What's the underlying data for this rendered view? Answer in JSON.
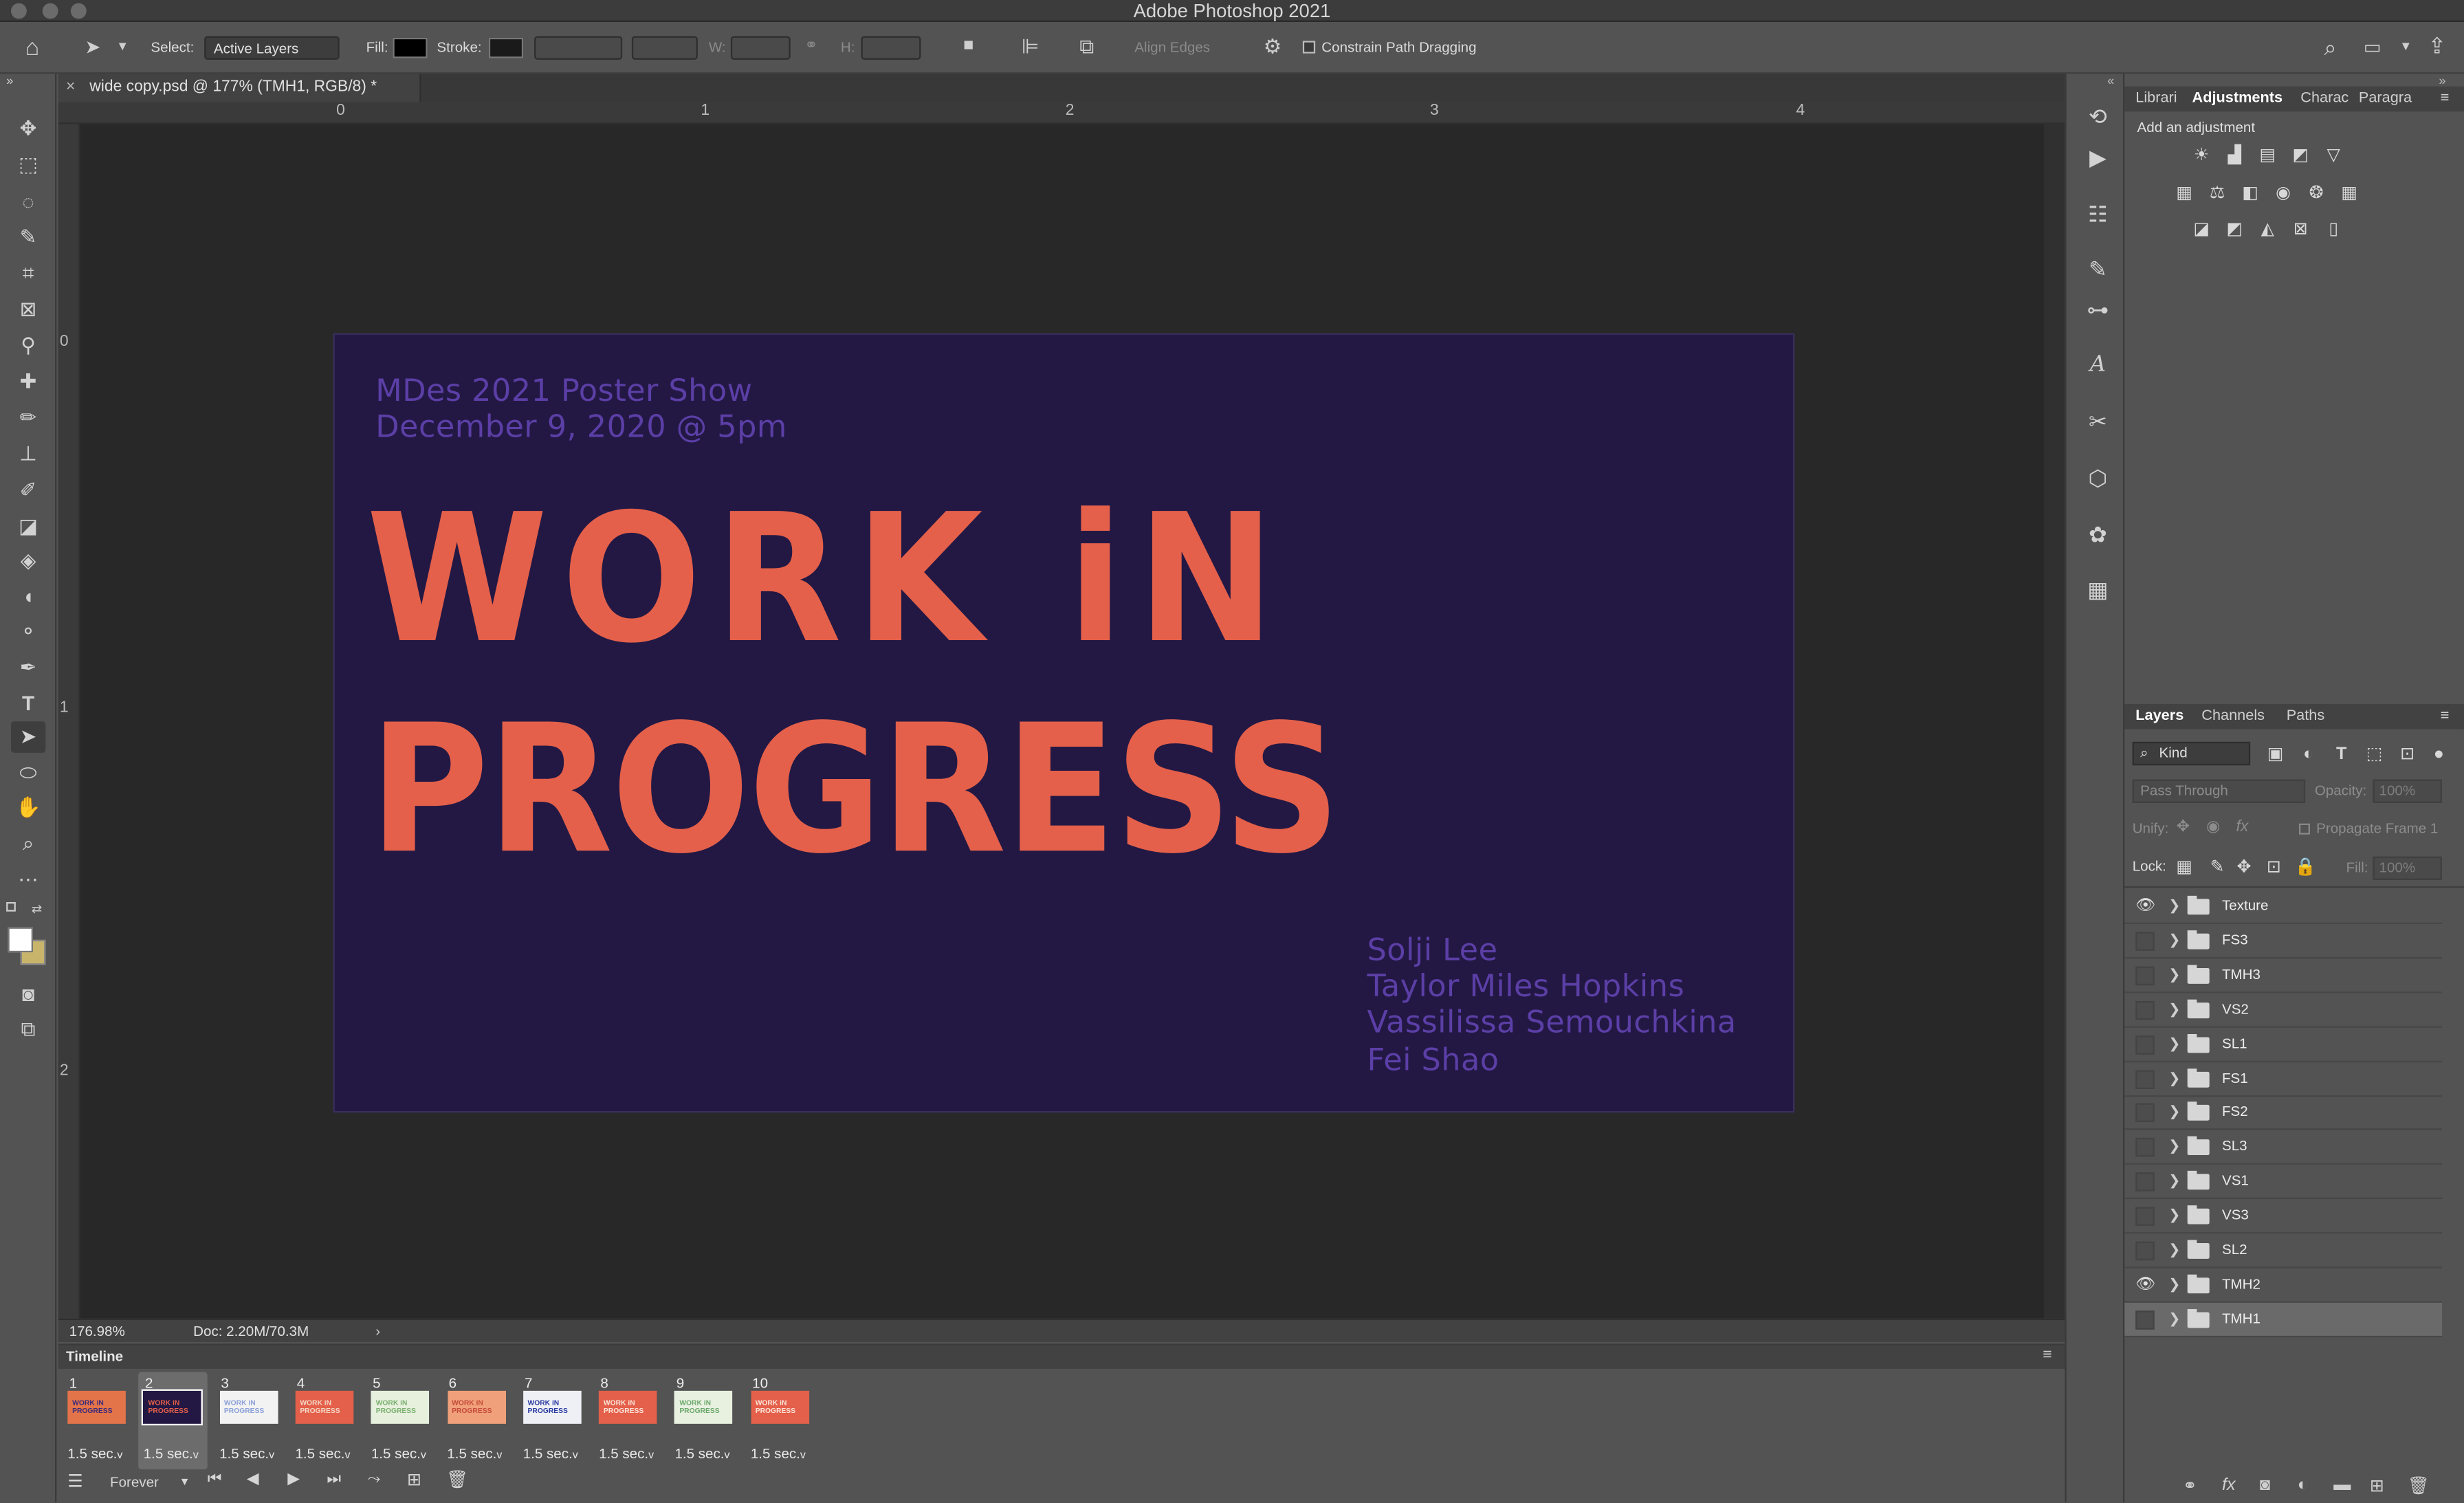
{
  "window": {
    "title": "Adobe Photoshop 2021"
  },
  "options": {
    "select_label": "Select:",
    "select_value": "Active Layers",
    "fill_label": "Fill:",
    "stroke_label": "Stroke:",
    "w_label": "W:",
    "h_label": "H:",
    "align_edges": "Align Edges",
    "constrain": "Constrain Path Dragging"
  },
  "document": {
    "tab": "wide copy.psd @ 177% (TMH1, RGB/8) *",
    "close": "×",
    "ruler_top": [
      "0",
      "1",
      "2",
      "3",
      "4"
    ],
    "ruler_left": [
      "0",
      "1",
      "2"
    ]
  },
  "poster": {
    "line1": "MDes 2021 Poster Show",
    "line2": "December 9, 2020 @ 5pm",
    "headline1": "WORK iN",
    "headline2": "PROGRESS",
    "names": [
      "Solji Lee",
      "Taylor Miles Hopkins",
      "Vassilissa Semouchkina",
      "Fei Shao"
    ],
    "bg": "#231844",
    "text_color": "#5b3fa6",
    "accent": "#e4604a"
  },
  "status": {
    "zoom": "176.98%",
    "doc": "Doc: 2.20M/70.3M"
  },
  "timeline": {
    "title": "Timeline",
    "loop": "Forever",
    "frames": [
      {
        "n": "1",
        "delay": "1.5 sec.",
        "bg": "#e3744a",
        "fg": "#3a2a7a"
      },
      {
        "n": "2",
        "delay": "1.5 sec.",
        "bg": "#231844",
        "fg": "#e4604a"
      },
      {
        "n": "3",
        "delay": "1.5 sec.",
        "bg": "#f2f2f2",
        "fg": "#8aa0d8"
      },
      {
        "n": "4",
        "delay": "1.5 sec.",
        "bg": "#e4604a",
        "fg": "#f4d8c8"
      },
      {
        "n": "5",
        "delay": "1.5 sec.",
        "bg": "#e6f0dc",
        "fg": "#7ab070"
      },
      {
        "n": "6",
        "delay": "1.5 sec.",
        "bg": "#f0a07a",
        "fg": "#c44a3a"
      },
      {
        "n": "7",
        "delay": "1.5 sec.",
        "bg": "#eef0f6",
        "fg": "#2a3aa0"
      },
      {
        "n": "8",
        "delay": "1.5 sec.",
        "bg": "#e4604a",
        "fg": "#fbe4da"
      },
      {
        "n": "9",
        "delay": "1.5 sec.",
        "bg": "#e8f0e0",
        "fg": "#6aa86a"
      },
      {
        "n": "10",
        "delay": "1.5 sec.",
        "bg": "#e4604a",
        "fg": "#fbe4da"
      }
    ]
  },
  "panels": {
    "top_tabs": [
      "Librari",
      "Adjustments",
      "Charac",
      "Paragra"
    ],
    "add_adjustment": "Add an adjustment",
    "layer_tabs": [
      "Layers",
      "Channels",
      "Paths"
    ],
    "kind": "Kind",
    "blend": "Pass Through",
    "opacity_label": "Opacity:",
    "opacity": "100%",
    "unify": "Unify:",
    "propagate": "Propagate Frame 1",
    "lock": "Lock:",
    "fill_label": "Fill:",
    "fill": "100%",
    "layers": [
      {
        "name": "Texture",
        "visible": true
      },
      {
        "name": "FS3",
        "visible": false
      },
      {
        "name": "TMH3",
        "visible": false
      },
      {
        "name": "VS2",
        "visible": false
      },
      {
        "name": "SL1",
        "visible": false
      },
      {
        "name": "FS1",
        "visible": false
      },
      {
        "name": "FS2",
        "visible": false
      },
      {
        "name": "SL3",
        "visible": false
      },
      {
        "name": "VS1",
        "visible": false
      },
      {
        "name": "VS3",
        "visible": false
      },
      {
        "name": "SL2",
        "visible": false
      },
      {
        "name": "TMH2",
        "visible": true
      },
      {
        "name": "TMH1",
        "visible": false,
        "selected": true
      }
    ]
  }
}
